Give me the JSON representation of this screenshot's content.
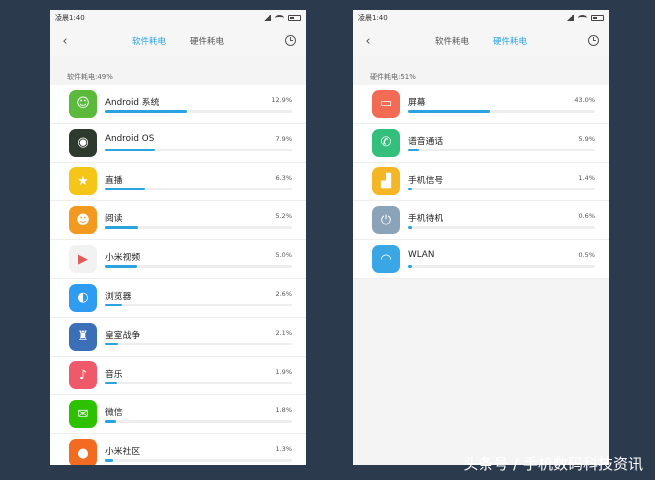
{
  "watermark": "头条号 / 手机数码科技资讯",
  "colors": {
    "accent": "#2aa3e0",
    "background": "#2c3a4e"
  },
  "left": {
    "status_time": "凌晨1:40",
    "tabs": [
      "软件耗电",
      "硬件耗电"
    ],
    "active_tab": 0,
    "section_label": "软件耗电:49%",
    "items": [
      {
        "name": "Android 系统",
        "percent": "12.9%",
        "value": 12.9,
        "icon": "android-system-icon",
        "color": "#5bba3c"
      },
      {
        "name": "Android OS",
        "percent": "7.9%",
        "value": 7.9,
        "icon": "android-os-icon",
        "color": "#2e3a2e"
      },
      {
        "name": "直播",
        "percent": "6.3%",
        "value": 6.3,
        "icon": "live-star-icon",
        "color": "#f5c518"
      },
      {
        "name": "阅读",
        "percent": "5.2%",
        "value": 5.2,
        "icon": "reading-icon",
        "color": "#f29a1f"
      },
      {
        "name": "小米视频",
        "percent": "5.0%",
        "value": 5.0,
        "icon": "play-icon",
        "color": "#f2f2f2"
      },
      {
        "name": "浏览器",
        "percent": "2.6%",
        "value": 2.6,
        "icon": "browser-icon",
        "color": "#2e9cf0"
      },
      {
        "name": "皇室战争",
        "percent": "2.1%",
        "value": 2.1,
        "icon": "clash-royale-icon",
        "color": "#3b6fb8"
      },
      {
        "name": "音乐",
        "percent": "1.9%",
        "value": 1.9,
        "icon": "music-icon",
        "color": "#ef5a6a"
      },
      {
        "name": "微信",
        "percent": "1.8%",
        "value": 1.8,
        "icon": "wechat-icon",
        "color": "#2dc100"
      },
      {
        "name": "小米社区",
        "percent": "1.3%",
        "value": 1.3,
        "icon": "mi-community-icon",
        "color": "#f36b21"
      }
    ]
  },
  "right": {
    "status_time": "凌晨1:40",
    "tabs": [
      "软件耗电",
      "硬件耗电"
    ],
    "active_tab": 1,
    "section_label": "硬件耗电:51%",
    "items": [
      {
        "name": "屏幕",
        "percent": "43.0%",
        "value": 43.0,
        "icon": "screen-icon",
        "color": "#f36b52"
      },
      {
        "name": "语音通话",
        "percent": "5.9%",
        "value": 5.9,
        "icon": "phone-call-icon",
        "color": "#34c07c"
      },
      {
        "name": "手机信号",
        "percent": "1.4%",
        "value": 1.4,
        "icon": "signal-bars-icon",
        "color": "#f5b626"
      },
      {
        "name": "手机待机",
        "percent": "0.6%",
        "value": 0.6,
        "icon": "power-icon",
        "color": "#8aa3b8"
      },
      {
        "name": "WLAN",
        "percent": "0.5%",
        "value": 0.5,
        "icon": "wifi-icon",
        "color": "#3aa6e6"
      }
    ]
  }
}
